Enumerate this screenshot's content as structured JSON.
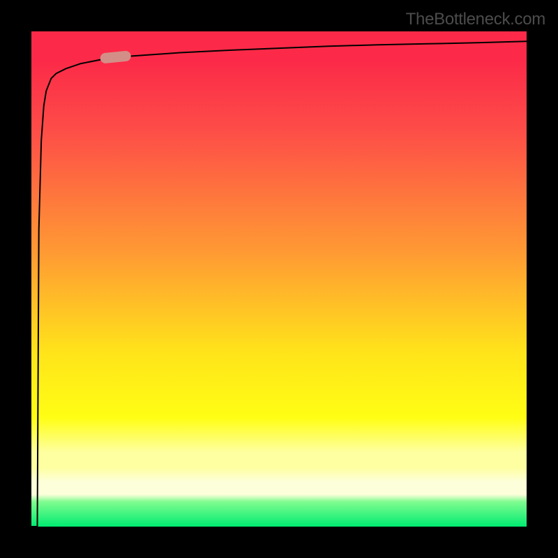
{
  "watermark": {
    "text": "TheBottleneck.com"
  },
  "colors": {
    "background": "#000000",
    "curve_stroke": "#000000",
    "marker_fill": "#d38f87",
    "gradient_stops": [
      "#fc2a48",
      "#fd4d48",
      "#ff9b33",
      "#ffe41a",
      "#fffe14",
      "#feffa0",
      "#fdffdb",
      "#7ffc8f",
      "#00eb71"
    ]
  },
  "chart_data": {
    "type": "line",
    "x": [
      0.0,
      0.012,
      0.015,
      0.02,
      0.025,
      0.03,
      0.04,
      0.05,
      0.07,
      0.1,
      0.15,
      0.2,
      0.3,
      0.4,
      0.5,
      0.6,
      0.7,
      0.8,
      0.9,
      1.0
    ],
    "values": [
      0.0,
      0.0,
      0.6,
      0.78,
      0.85,
      0.88,
      0.905,
      0.915,
      0.925,
      0.935,
      0.945,
      0.95,
      0.957,
      0.962,
      0.966,
      0.97,
      0.973,
      0.975,
      0.977,
      0.98
    ],
    "marker": {
      "x": 0.17,
      "y": 0.948
    },
    "title": "",
    "xlabel": "",
    "ylabel": "",
    "xlim": [
      0,
      1
    ],
    "ylim": [
      0,
      1
    ]
  }
}
